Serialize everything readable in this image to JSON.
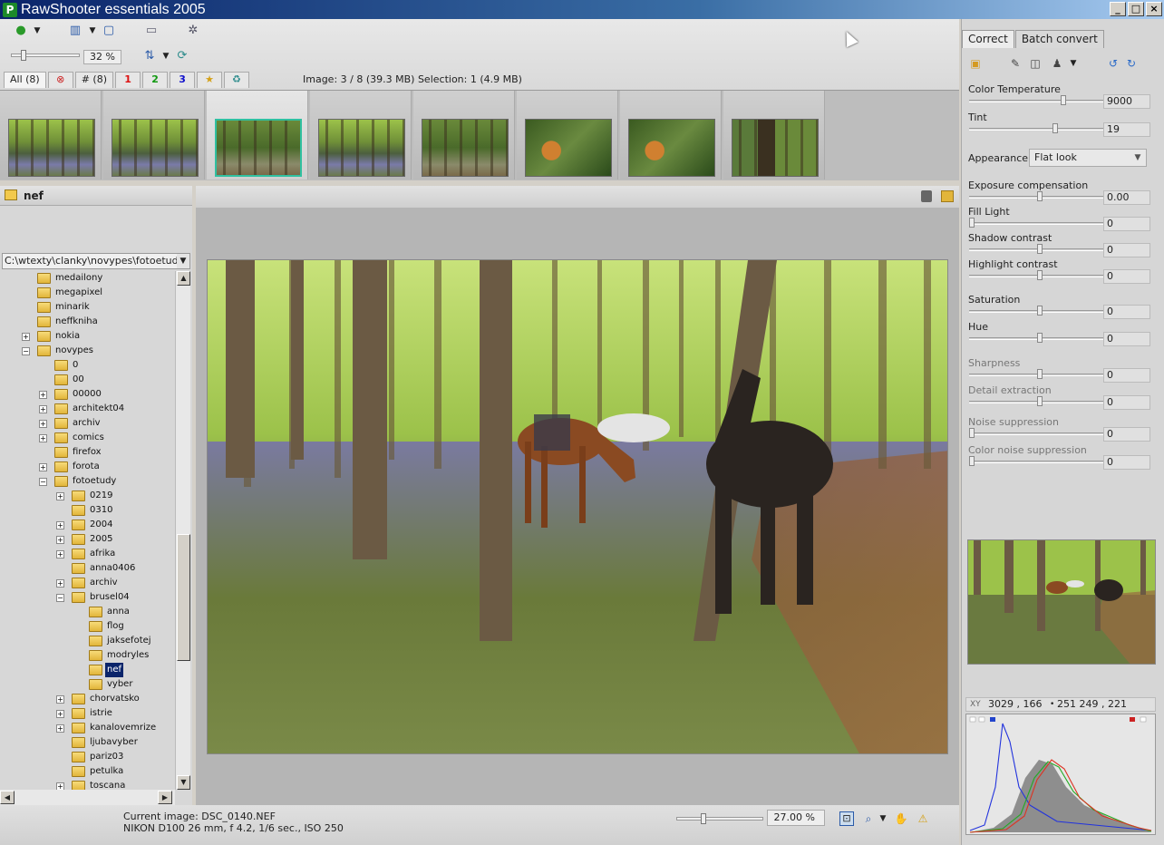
{
  "window": {
    "title": "RawShooter essentials 2005",
    "logo_letter": "P",
    "minimize": "_",
    "maximize": "□",
    "close": "×"
  },
  "toolbar": {
    "zoom_value": "32 %",
    "filter_tabs": [
      {
        "label": "All (8)",
        "color": "#222222"
      },
      {
        "label": "⊗",
        "color": "#cc2222"
      },
      {
        "label": "# (8)",
        "color": "#222222"
      },
      {
        "label": "1",
        "color": "#dd1111"
      },
      {
        "label": "2",
        "color": "#119911"
      },
      {
        "label": "3",
        "color": "#1111cc"
      },
      {
        "label": "★",
        "color": "#d4a017"
      },
      {
        "label": "♻",
        "color": "#2a8a8a"
      }
    ],
    "image_info": "Image: 3 / 8 (39.3 MB)  Selection: 1 (4.9 MB)"
  },
  "filmstrip": {
    "selected_index": 2,
    "count": 8
  },
  "folder_panel": {
    "title": "nef",
    "path": "C:\\wtexty\\clanky\\novypes\\fotoetudy\\br",
    "tree": [
      {
        "label": "medailony",
        "depth": 0,
        "exp": ""
      },
      {
        "label": "megapixel",
        "depth": 0,
        "exp": ""
      },
      {
        "label": "minarik",
        "depth": 0,
        "exp": ""
      },
      {
        "label": "neffkniha",
        "depth": 0,
        "exp": ""
      },
      {
        "label": "nokia",
        "depth": 0,
        "exp": "+"
      },
      {
        "label": "novypes",
        "depth": 0,
        "exp": "-"
      },
      {
        "label": "0",
        "depth": 1,
        "exp": ""
      },
      {
        "label": "00",
        "depth": 1,
        "exp": ""
      },
      {
        "label": "00000",
        "depth": 1,
        "exp": "+"
      },
      {
        "label": "architekt04",
        "depth": 1,
        "exp": "+"
      },
      {
        "label": "archiv",
        "depth": 1,
        "exp": "+"
      },
      {
        "label": "comics",
        "depth": 1,
        "exp": "+"
      },
      {
        "label": "firefox",
        "depth": 1,
        "exp": ""
      },
      {
        "label": "forota",
        "depth": 1,
        "exp": "+"
      },
      {
        "label": "fotoetudy",
        "depth": 1,
        "exp": "-"
      },
      {
        "label": "0219",
        "depth": 2,
        "exp": "+"
      },
      {
        "label": "0310",
        "depth": 2,
        "exp": ""
      },
      {
        "label": "2004",
        "depth": 2,
        "exp": "+"
      },
      {
        "label": "2005",
        "depth": 2,
        "exp": "+"
      },
      {
        "label": "afrika",
        "depth": 2,
        "exp": "+"
      },
      {
        "label": "anna0406",
        "depth": 2,
        "exp": ""
      },
      {
        "label": "archiv",
        "depth": 2,
        "exp": "+"
      },
      {
        "label": "brusel04",
        "depth": 2,
        "exp": "-"
      },
      {
        "label": "anna",
        "depth": 3,
        "exp": ""
      },
      {
        "label": "flog",
        "depth": 3,
        "exp": ""
      },
      {
        "label": "jaksefotej",
        "depth": 3,
        "exp": ""
      },
      {
        "label": "modryles",
        "depth": 3,
        "exp": ""
      },
      {
        "label": "nef",
        "depth": 3,
        "exp": "",
        "selected": true
      },
      {
        "label": "vyber",
        "depth": 3,
        "exp": ""
      },
      {
        "label": "chorvatsko",
        "depth": 2,
        "exp": "+"
      },
      {
        "label": "istrie",
        "depth": 2,
        "exp": "+"
      },
      {
        "label": "kanalovemrize",
        "depth": 2,
        "exp": "+"
      },
      {
        "label": "ljubavyber",
        "depth": 2,
        "exp": ""
      },
      {
        "label": "pariz03",
        "depth": 2,
        "exp": ""
      },
      {
        "label": "petulka",
        "depth": 2,
        "exp": ""
      },
      {
        "label": "toscana",
        "depth": 2,
        "exp": "+"
      }
    ]
  },
  "status": {
    "current_image": "Current image: DSC_0140.NEF",
    "exif": "NIKON D100    26 mm, f 4.2, 1/6 sec., ISO 250",
    "view_zoom": "27.00 %"
  },
  "right_panel": {
    "tabs": [
      {
        "label": "Correct",
        "active": true
      },
      {
        "label": "Batch convert",
        "active": false
      }
    ],
    "adjustments": [
      {
        "label": "Color Temperature",
        "value": "9000",
        "level": 0.68,
        "dim": false
      },
      {
        "label": "Tint",
        "value": "19",
        "level": 0.62,
        "dim": false
      },
      {
        "label": "Exposure compensation",
        "value": "0.00",
        "level": 0.5,
        "dim": false
      },
      {
        "label": "Fill Light",
        "value": "0",
        "level": 0.0,
        "dim": false
      },
      {
        "label": "Shadow contrast",
        "value": "0",
        "level": 0.5,
        "dim": false
      },
      {
        "label": "Highlight contrast",
        "value": "0",
        "level": 0.5,
        "dim": false
      },
      {
        "label": "Saturation",
        "value": "0",
        "level": 0.5,
        "dim": false
      },
      {
        "label": "Hue",
        "value": "0",
        "level": 0.5,
        "dim": false
      },
      {
        "label": "Sharpness",
        "value": "0",
        "level": 0.5,
        "dim": true
      },
      {
        "label": "Detail extraction",
        "value": "0",
        "level": 0.5,
        "dim": true
      },
      {
        "label": "Noise suppression",
        "value": "0",
        "level": 0.0,
        "dim": true
      },
      {
        "label": "Color noise suppression",
        "value": "0",
        "level": 0.0,
        "dim": true
      }
    ],
    "appearance": {
      "label": "Appearance",
      "value": "Flat look"
    },
    "histogram_info": {
      "xy_label": "XY",
      "coords": "3029 , 166",
      "rgb": "251    249 , 221"
    }
  }
}
